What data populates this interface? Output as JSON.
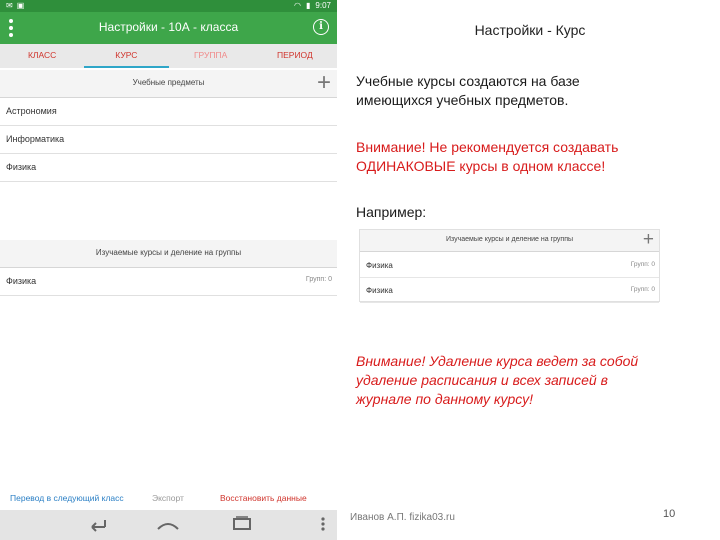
{
  "statusbar": {
    "time": "9:07"
  },
  "colors": {
    "appbar": "#3ea64a",
    "tab_text": "#d0342c",
    "tab_indicator": "#2fa6c8",
    "link_blue": "#2a7fc5",
    "red_text": "#d81b1b"
  },
  "appbar": {
    "title": "Настройки - 10А - класса",
    "menu_icon": "overflow-menu-icon",
    "info_icon": "info-icon",
    "info_glyph": "i"
  },
  "tabs": [
    {
      "label": "КЛАСС"
    },
    {
      "label": "КУРС"
    },
    {
      "label": "ГРУППА"
    },
    {
      "label": "ПЕРИОД"
    }
  ],
  "subjects": {
    "header": "Учебные предметы",
    "plus": "+",
    "items": [
      "Астрономия",
      "Информатика",
      "Физика"
    ]
  },
  "courses": {
    "header": "Изучаемые курсы и деление на группы",
    "items": [
      {
        "name": "Физика",
        "meta": "Групп: 0"
      }
    ]
  },
  "actions": {
    "transfer": "Перевод в следующий класс",
    "export": "Экспорт",
    "restore": "Восстановить данные"
  },
  "slide": {
    "title": "Настройки - Курс",
    "p1_line1": "Учебные курсы создаются на базе",
    "p1_line2": "имеющихся учебных предметов.",
    "p2_line1": "Внимание! Не рекомендуется создавать",
    "p2_line2": "ОДИНАКОВЫЕ курсы в одном классе!",
    "example": "Например:",
    "inset_header": "Изучаемые курсы и деление на группы",
    "inset_plus": "+",
    "inset_items": [
      {
        "name": "Физика",
        "meta": "Групп: 0"
      },
      {
        "name": "Физика",
        "meta": "Групп: 0"
      }
    ],
    "p3_line1": "Внимание! Удаление курса ведет за собой",
    "p3_line2": "удаление расписания и всех записей в",
    "p3_line3": "журнале по данному курсу!",
    "author": "Иванов А.П. fizika03.ru",
    "page": "10"
  }
}
